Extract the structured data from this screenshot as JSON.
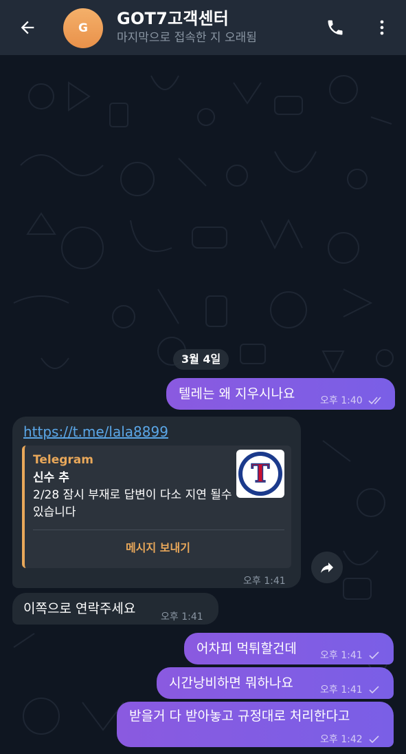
{
  "header": {
    "avatar_letter": "G",
    "title": "GOT7고객센터",
    "status": "마지막으로 접속한 지 오래됨",
    "back_icon": "arrow-left-icon",
    "call_icon": "phone-icon",
    "more_icon": "more-vertical-icon"
  },
  "date_separator": "3월 4일",
  "messages": [
    {
      "direction": "out",
      "text": "텔레는 왜 지우시나요",
      "time": "오후 1:40",
      "status": "read"
    },
    {
      "direction": "in",
      "link": "https://t.me/lala8899",
      "preview": {
        "site": "Telegram",
        "title": "신수 추",
        "description": "2/28 잠시 부재로 답변이 다소 지연 될수있습니다",
        "thumbnail_letter": "T",
        "action": "메시지 보내기"
      },
      "time": "오후 1:41"
    },
    {
      "direction": "in",
      "text": "이쪽으로 연락주세요",
      "time": "오후 1:41"
    },
    {
      "direction": "out",
      "text": "어차피 먹튀할건데",
      "time": "오후 1:41",
      "status": "sent"
    },
    {
      "direction": "out",
      "text": "시간낭비하면 뭐하나요",
      "time": "오후 1:41",
      "status": "sent"
    },
    {
      "direction": "out",
      "text": "받을거 다 받아놓고 규정대로 처리한다고",
      "time": "오후 1:42",
      "status": "sent"
    }
  ],
  "colors": {
    "header_bg": "#222b38",
    "outgoing_bubble": "#8a5ae0",
    "incoming_bubble": "#222a33",
    "link": "#5ba7e8",
    "preview_accent": "#e9a85a",
    "avatar": "#f0a05e"
  }
}
